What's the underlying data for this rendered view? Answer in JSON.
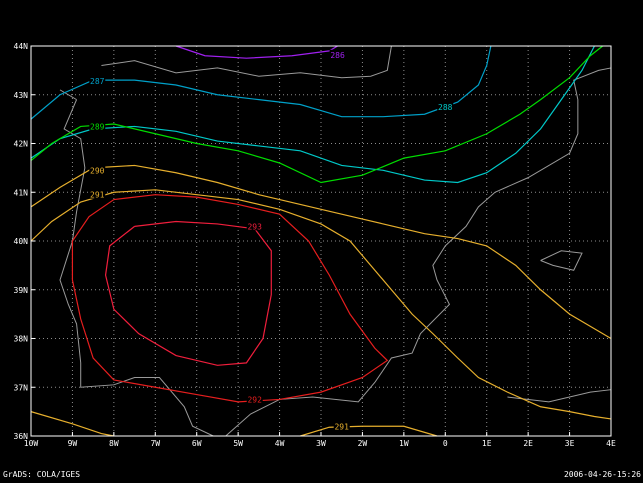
{
  "footer": {
    "left": "GrADS: COLA/IGES",
    "right": "2006-04-26-15:26"
  },
  "chart_data": {
    "type": "contour",
    "title": "",
    "xlabel": "",
    "ylabel": "",
    "xlim": [
      -10,
      4
    ],
    "ylim": [
      36,
      44
    ],
    "grid": true,
    "x_ticks": [
      {
        "v": -10,
        "label": "10W"
      },
      {
        "v": -9,
        "label": "9W"
      },
      {
        "v": -8,
        "label": "8W"
      },
      {
        "v": -7,
        "label": "7W"
      },
      {
        "v": -6,
        "label": "6W"
      },
      {
        "v": -5,
        "label": "5W"
      },
      {
        "v": -4,
        "label": "4W"
      },
      {
        "v": -3,
        "label": "3W"
      },
      {
        "v": -2,
        "label": "2W"
      },
      {
        "v": -1,
        "label": "1W"
      },
      {
        "v": 0,
        "label": "0"
      },
      {
        "v": 1,
        "label": "1E"
      },
      {
        "v": 2,
        "label": "2E"
      },
      {
        "v": 3,
        "label": "3E"
      },
      {
        "v": 4,
        "label": "4E"
      }
    ],
    "y_ticks": [
      {
        "v": 36,
        "label": "36N"
      },
      {
        "v": 37,
        "label": "37N"
      },
      {
        "v": 38,
        "label": "38N"
      },
      {
        "v": 39,
        "label": "39N"
      },
      {
        "v": 40,
        "label": "40N"
      },
      {
        "v": 41,
        "label": "41N"
      },
      {
        "v": 42,
        "label": "42N"
      },
      {
        "v": 43,
        "label": "43N"
      },
      {
        "v": 44,
        "label": "44N"
      }
    ],
    "contours": [
      {
        "level": "286",
        "color": "#a020f0",
        "points": [
          [
            -6.5,
            44
          ],
          [
            -5.8,
            43.8
          ],
          [
            -4.8,
            43.75
          ],
          [
            -3.7,
            43.8
          ],
          [
            -2.8,
            43.9
          ],
          [
            -2.6,
            44
          ]
        ],
        "label_at": [
          -2.6,
          43.82
        ]
      },
      {
        "level": "287",
        "color": "#00a0c8",
        "points": [
          [
            -10,
            42.5
          ],
          [
            -9.3,
            43.0
          ],
          [
            -8.5,
            43.3
          ],
          [
            -7.5,
            43.3
          ],
          [
            -6.5,
            43.2
          ],
          [
            -5.5,
            43.0
          ],
          [
            -4.5,
            42.9
          ],
          [
            -3.5,
            42.8
          ],
          [
            -2.5,
            42.55
          ],
          [
            -1.5,
            42.55
          ],
          [
            -0.5,
            42.6
          ],
          [
            0.3,
            42.85
          ],
          [
            0.8,
            43.2
          ],
          [
            1.0,
            43.6
          ],
          [
            1.1,
            44
          ]
        ],
        "label_at": [
          -8.4,
          43.28
        ]
      },
      {
        "level": "288",
        "color": "#00c8c8",
        "points": [
          [
            -10,
            41.7
          ],
          [
            -9.3,
            42.1
          ],
          [
            -8.5,
            42.3
          ],
          [
            -7.5,
            42.35
          ],
          [
            -6.5,
            42.25
          ],
          [
            -5.5,
            42.05
          ],
          [
            -4.5,
            41.95
          ],
          [
            -3.5,
            41.85
          ],
          [
            -2.5,
            41.55
          ],
          [
            -1.5,
            41.45
          ],
          [
            -0.5,
            41.25
          ],
          [
            0.3,
            41.2
          ],
          [
            1.0,
            41.4
          ],
          [
            1.7,
            41.8
          ],
          [
            2.3,
            42.3
          ],
          [
            2.8,
            42.9
          ],
          [
            3.3,
            43.5
          ],
          [
            3.6,
            44
          ]
        ],
        "label_at": [
          0,
          42.75
        ]
      },
      {
        "level": "289",
        "color": "#00dc00",
        "points": [
          [
            -10,
            41.65
          ],
          [
            -9.5,
            42.0
          ],
          [
            -8.8,
            42.35
          ],
          [
            -8.0,
            42.4
          ],
          [
            -7.0,
            42.2
          ],
          [
            -6.0,
            42.0
          ],
          [
            -5.0,
            41.85
          ],
          [
            -4.0,
            41.6
          ],
          [
            -3.0,
            41.2
          ],
          [
            -2.0,
            41.35
          ],
          [
            -1.0,
            41.7
          ],
          [
            0.0,
            41.85
          ],
          [
            1.0,
            42.2
          ],
          [
            1.8,
            42.6
          ],
          [
            2.3,
            42.9
          ],
          [
            3.0,
            43.35
          ],
          [
            3.5,
            43.8
          ],
          [
            3.8,
            44
          ]
        ],
        "label_at": [
          -8.4,
          42.35
        ]
      },
      {
        "level": "290",
        "color": "#e6af2d",
        "points": [
          [
            -10,
            40.7
          ],
          [
            -9.3,
            41.1
          ],
          [
            -8.5,
            41.5
          ],
          [
            -7.5,
            41.55
          ],
          [
            -6.5,
            41.4
          ],
          [
            -5.5,
            41.2
          ],
          [
            -4.5,
            40.95
          ],
          [
            -3.5,
            40.75
          ],
          [
            -2.5,
            40.55
          ],
          [
            -1.5,
            40.35
          ],
          [
            -0.5,
            40.15
          ],
          [
            0.3,
            40.05
          ],
          [
            1.0,
            39.9
          ],
          [
            1.7,
            39.5
          ],
          [
            2.3,
            39.0
          ],
          [
            3.0,
            38.5
          ],
          [
            3.6,
            38.2
          ],
          [
            4,
            38.0
          ]
        ],
        "label_at": [
          -8.4,
          41.45
        ]
      },
      {
        "level": "291",
        "color": "#e6af2d",
        "points": [
          [
            -10,
            40.0
          ],
          [
            -9.5,
            40.4
          ],
          [
            -8.8,
            40.8
          ],
          [
            -8.0,
            41.0
          ],
          [
            -7.0,
            41.05
          ],
          [
            -6.0,
            40.95
          ],
          [
            -5.0,
            40.85
          ],
          [
            -4.0,
            40.65
          ],
          [
            -3.0,
            40.35
          ],
          [
            -2.3,
            40.0
          ],
          [
            -1.8,
            39.5
          ],
          [
            -1.3,
            39.0
          ],
          [
            -0.8,
            38.5
          ],
          [
            -0.3,
            38.1
          ],
          [
            0.3,
            37.6
          ],
          [
            0.8,
            37.2
          ],
          [
            1.5,
            36.9
          ],
          [
            2.3,
            36.6
          ],
          [
            3.0,
            36.5
          ],
          [
            3.6,
            36.4
          ],
          [
            4,
            36.35
          ]
        ],
        "label_at": [
          -8.4,
          40.95
        ]
      },
      {
        "level": "291",
        "color": "#e6af2d",
        "points": [
          [
            -10,
            36.5
          ],
          [
            -9.0,
            36.25
          ],
          [
            -8.3,
            36.05
          ],
          [
            -8.0,
            36
          ]
        ],
        "label_at": null
      },
      {
        "level": "291",
        "color": "#e6af2d",
        "points": [
          [
            -3.5,
            36
          ],
          [
            -2.8,
            36.18
          ],
          [
            -2.0,
            36.2
          ],
          [
            -1.0,
            36.2
          ],
          [
            -0.2,
            36
          ]
        ],
        "label_at": [
          -2.5,
          36.2
        ]
      },
      {
        "level": "292",
        "color": "#e61e1e",
        "points": [
          [
            -8.0,
            40.85
          ],
          [
            -7.0,
            40.95
          ],
          [
            -6.0,
            40.9
          ],
          [
            -5.0,
            40.75
          ],
          [
            -4.0,
            40.55
          ],
          [
            -3.3,
            40.0
          ],
          [
            -2.8,
            39.3
          ],
          [
            -2.3,
            38.5
          ],
          [
            -1.7,
            37.8
          ],
          [
            -1.4,
            37.55
          ],
          [
            -2.0,
            37.2
          ],
          [
            -3.0,
            36.9
          ],
          [
            -4.0,
            36.75
          ],
          [
            -5.0,
            36.7
          ],
          [
            -6.0,
            36.85
          ],
          [
            -7.0,
            37.0
          ],
          [
            -8.0,
            37.15
          ],
          [
            -8.5,
            37.6
          ],
          [
            -8.8,
            38.4
          ],
          [
            -9.0,
            39.2
          ],
          [
            -9.0,
            40.0
          ],
          [
            -8.6,
            40.5
          ],
          [
            -8.0,
            40.85
          ]
        ],
        "label_at": [
          -4.6,
          36.75
        ]
      },
      {
        "level": "293",
        "color": "#f01e3c",
        "points": [
          [
            -7.5,
            40.3
          ],
          [
            -6.5,
            40.4
          ],
          [
            -5.5,
            40.35
          ],
          [
            -4.6,
            40.25
          ],
          [
            -4.2,
            39.8
          ],
          [
            -4.2,
            38.9
          ],
          [
            -4.4,
            38.0
          ],
          [
            -4.8,
            37.5
          ],
          [
            -5.5,
            37.45
          ],
          [
            -6.5,
            37.65
          ],
          [
            -7.4,
            38.1
          ],
          [
            -8.0,
            38.6
          ],
          [
            -8.2,
            39.3
          ],
          [
            -8.1,
            39.9
          ],
          [
            -7.5,
            40.3
          ]
        ],
        "label_at": [
          -4.6,
          40.3
        ]
      }
    ],
    "map_outlines": [
      [
        [
          -8.3,
          43.6
        ],
        [
          -7.5,
          43.7
        ],
        [
          -6.5,
          43.45
        ],
        [
          -5.5,
          43.55
        ],
        [
          -4.5,
          43.38
        ],
        [
          -3.5,
          43.45
        ],
        [
          -2.5,
          43.35
        ],
        [
          -1.8,
          43.38
        ],
        [
          -1.4,
          43.5
        ],
        [
          -1.3,
          44
        ]
      ],
      [
        [
          -8.9,
          42.9
        ],
        [
          -9.2,
          42.3
        ],
        [
          -8.8,
          42.1
        ],
        [
          -8.7,
          41.5
        ],
        [
          -8.9,
          40.6
        ],
        [
          -9.0,
          40.0
        ],
        [
          -9.3,
          39.2
        ],
        [
          -9.1,
          38.7
        ],
        [
          -8.9,
          38.3
        ],
        [
          -8.8,
          37.5
        ],
        [
          -8.8,
          37.0
        ],
        [
          -8.0,
          37.05
        ],
        [
          -7.5,
          37.2
        ],
        [
          -6.9,
          37.2
        ],
        [
          -6.3,
          36.6
        ],
        [
          -6.1,
          36.2
        ],
        [
          -5.6,
          36.0
        ]
      ],
      [
        [
          -9.3,
          43.1
        ],
        [
          -8.9,
          42.9
        ]
      ],
      [
        [
          -5.3,
          36.0
        ],
        [
          -4.7,
          36.45
        ],
        [
          -4.0,
          36.75
        ],
        [
          -3.2,
          36.8
        ],
        [
          -2.1,
          36.7
        ],
        [
          -1.7,
          37.1
        ],
        [
          -1.3,
          37.6
        ],
        [
          -0.8,
          37.7
        ],
        [
          -0.6,
          38.1
        ],
        [
          0.1,
          38.7
        ],
        [
          -0.2,
          39.2
        ],
        [
          -0.3,
          39.5
        ],
        [
          0.0,
          39.9
        ],
        [
          0.5,
          40.3
        ],
        [
          0.8,
          40.7
        ],
        [
          1.2,
          41.0
        ],
        [
          2.0,
          41.3
        ],
        [
          3.0,
          41.8
        ],
        [
          3.2,
          42.2
        ],
        [
          3.2,
          42.9
        ],
        [
          3.1,
          43.3
        ],
        [
          3.7,
          43.5
        ],
        [
          4,
          43.55
        ]
      ],
      [
        [
          2.3,
          39.6
        ],
        [
          2.8,
          39.8
        ],
        [
          3.3,
          39.75
        ],
        [
          3.1,
          39.4
        ],
        [
          2.6,
          39.5
        ],
        [
          2.3,
          39.6
        ]
      ],
      [
        [
          1.5,
          36.8
        ],
        [
          2.5,
          36.7
        ],
        [
          3.5,
          36.9
        ],
        [
          4,
          36.95
        ]
      ]
    ]
  }
}
